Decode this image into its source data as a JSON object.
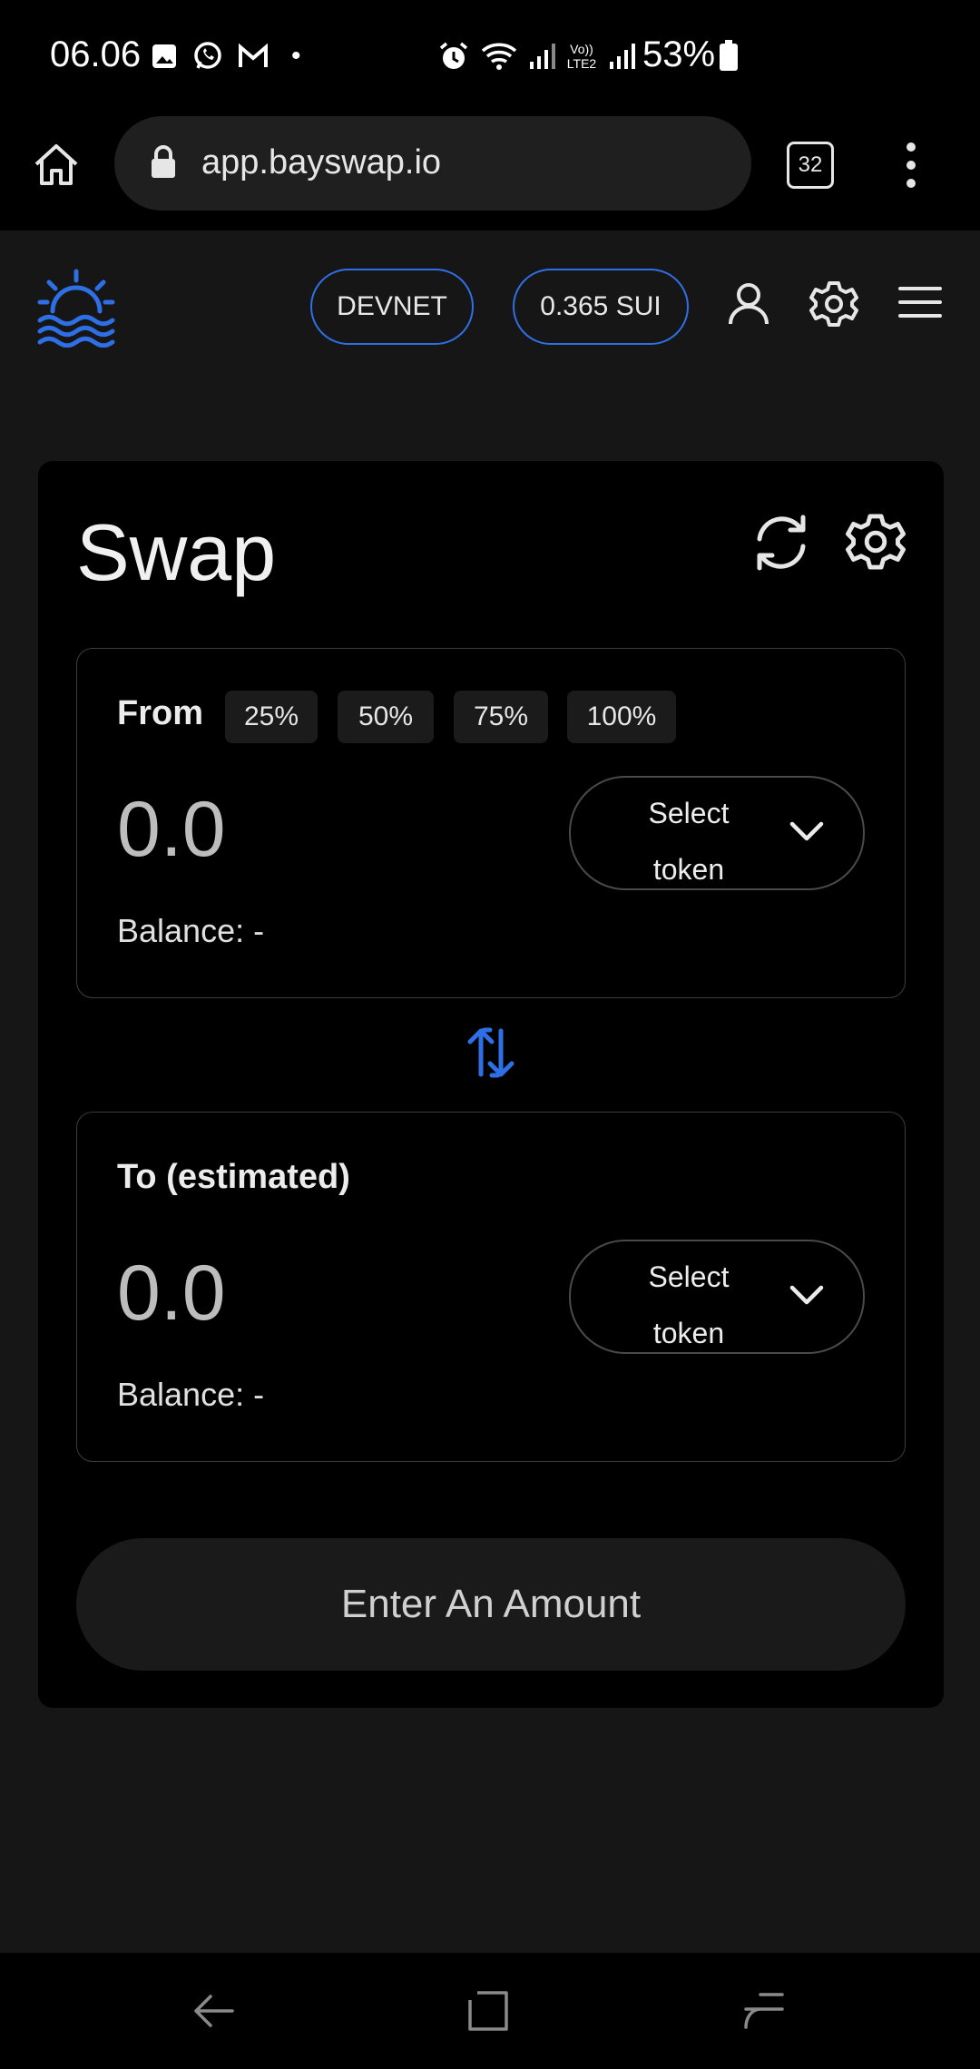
{
  "status_bar": {
    "time": "06.06",
    "dot": "•",
    "battery_text": "53%",
    "icons_left": [
      "gallery-icon",
      "whatsapp-icon",
      "gmail-icon"
    ],
    "icons_right": [
      "alarm-icon",
      "wifi-icon",
      "signal-icon",
      "volte-icon",
      "signal-icon",
      "battery-icon"
    ],
    "volte_label": "Vo)) LTE2"
  },
  "browser": {
    "url": "app.bayswap.io",
    "tab_count": "32"
  },
  "header": {
    "network": "DEVNET",
    "wallet_balance": "0.365 SUI",
    "accent": "#2f6fe6"
  },
  "swap": {
    "title": "Swap",
    "from": {
      "label": "From",
      "percent_buttons": [
        "25%",
        "50%",
        "75%",
        "100%"
      ],
      "amount_placeholder": "0.0",
      "balance": "Balance: -",
      "select_line1": "Select",
      "select_line2": "token"
    },
    "to": {
      "label": "To (estimated)",
      "amount_placeholder": "0.0",
      "balance": "Balance: -",
      "select_line1": "Select",
      "select_line2": "token"
    },
    "submit_label": "Enter An Amount"
  }
}
